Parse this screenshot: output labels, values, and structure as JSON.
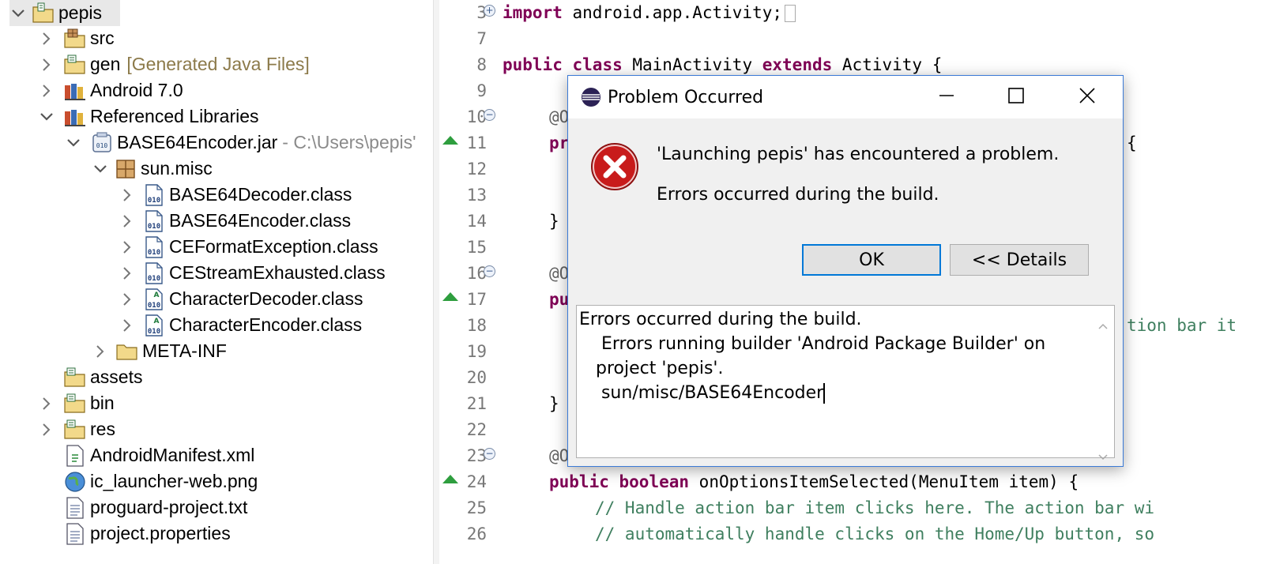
{
  "explorer": {
    "project": "pepis",
    "src": "src",
    "gen": "gen",
    "gen_deco": "[Generated Java Files]",
    "android": "Android 7.0",
    "reflibs": "Referenced Libraries",
    "jar": "BASE64Encoder.jar",
    "jar_deco": "- C:\\Users\\pepis'",
    "package": "sun.misc",
    "classes": [
      "BASE64Decoder.class",
      "BASE64Encoder.class",
      "CEFormatException.class",
      "CEStreamExhausted.class",
      "CharacterDecoder.class",
      "CharacterEncoder.class"
    ],
    "metainf": "META-INF",
    "assets": "assets",
    "bin": "bin",
    "res": "res",
    "manifest": "AndroidManifest.xml",
    "png": "ic_launcher-web.png",
    "proguard": "proguard-project.txt",
    "props": "project.properties"
  },
  "editor": {
    "line_numbers": [
      "3",
      "7",
      "8",
      "9",
      "10",
      "11",
      "12",
      "13",
      "14",
      "15",
      "16",
      "17",
      "18",
      "19",
      "20",
      "21",
      "22",
      "23",
      "24",
      "25",
      "26"
    ],
    "l3_kw": "import",
    "l3_rest": " android.app.Activity;",
    "l8_kw1": "public",
    "l8_kw2": "class",
    "l8_mid": " MainActivity ",
    "l8_kw3": "extends",
    "l8_rest": " Activity {",
    "l10": "@O",
    "l11": "pr",
    "l11_right": "{",
    "l14": "}",
    "l16": "@O",
    "l17": "pu",
    "l18_right": "tion bar it",
    "l21": "}",
    "l23": "@O",
    "l24_kw1": "public",
    "l24_kw2": "boolean",
    "l24_rest": " onOptionsItemSelected(MenuItem item) {",
    "l25": "// Handle action bar item clicks here. The action bar wi",
    "l26": "// automatically handle clicks on the Home/Up button, so"
  },
  "dialog": {
    "title": "Problem Occurred",
    "message": "'Launching pepis' has encountered a problem.",
    "submessage": "Errors occurred during the build.",
    "ok_label": "OK",
    "details_label": "<< Details",
    "details_lines": [
      "Errors occurred during the build.",
      "    Errors running builder 'Android Package Builder' on",
      "   project 'pepis'.",
      "    sun/misc/BASE64Encoder"
    ]
  }
}
